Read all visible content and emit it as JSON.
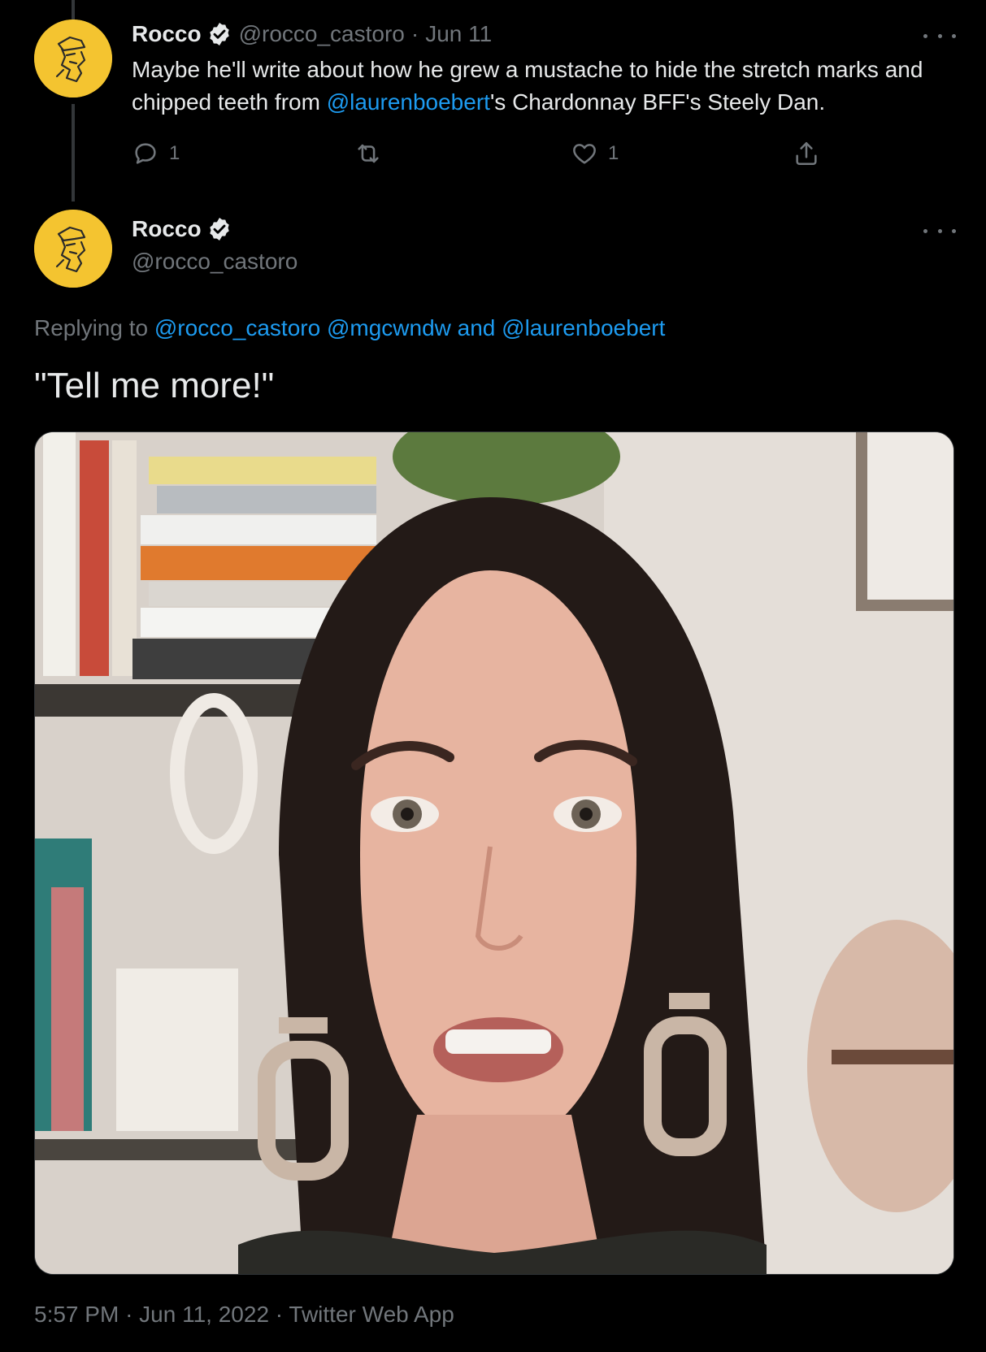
{
  "colors": {
    "background": "#000000",
    "primary_text": "#e7e9ea",
    "secondary_text": "#71767b",
    "link": "#1d9bf0",
    "avatar_bg": "#f4c430"
  },
  "parent_tweet": {
    "display_name": "Rocco",
    "verified_icon": "verified-badge",
    "handle": "@rocco_castoro",
    "separator": "·",
    "date": "Jun 11",
    "text_before": "Maybe he'll write about how he grew a mustache to hide the stretch marks and chipped teeth from ",
    "mention": "@laurenboebert",
    "text_after": "'s Chardonnay BFF's Steely Dan.",
    "actions": {
      "reply_count": "1",
      "retweet_count": "",
      "like_count": "1"
    }
  },
  "main_tweet": {
    "display_name": "Rocco",
    "handle": "@rocco_castoro",
    "replying_prefix": "Replying to ",
    "reply_mention_1": "@rocco_castoro",
    "reply_mention_2": "@mgcwndw",
    "reply_and": " and ",
    "reply_mention_3": "@laurenboebert",
    "text": "\"Tell me more!\"",
    "media": {
      "type": "video-still",
      "description_icon": "embedded-video-frame"
    },
    "footer": {
      "time": "5:57 PM",
      "separator": "·",
      "date": "Jun 11, 2022",
      "source": "Twitter Web App"
    }
  }
}
